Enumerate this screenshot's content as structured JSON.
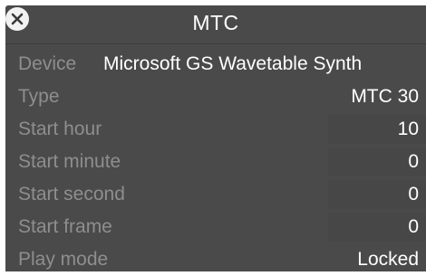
{
  "window": {
    "title": "MTC",
    "close_icon": "close-circle-icon"
  },
  "rows": [
    {
      "label": "Device",
      "value": "Microsoft GS Wavetable Synth"
    },
    {
      "label": "Type",
      "value": "MTC 30"
    },
    {
      "label": "Start hour",
      "value": "10"
    },
    {
      "label": "Start minute",
      "value": "0"
    },
    {
      "label": "Start second",
      "value": "0"
    },
    {
      "label": "Start frame",
      "value": "0"
    },
    {
      "label": "Play mode",
      "value": "Locked"
    }
  ],
  "colors": {
    "panel_bg": "#4a4a4a",
    "label_text": "#8e8e8e",
    "value_text": "#ffffff"
  }
}
